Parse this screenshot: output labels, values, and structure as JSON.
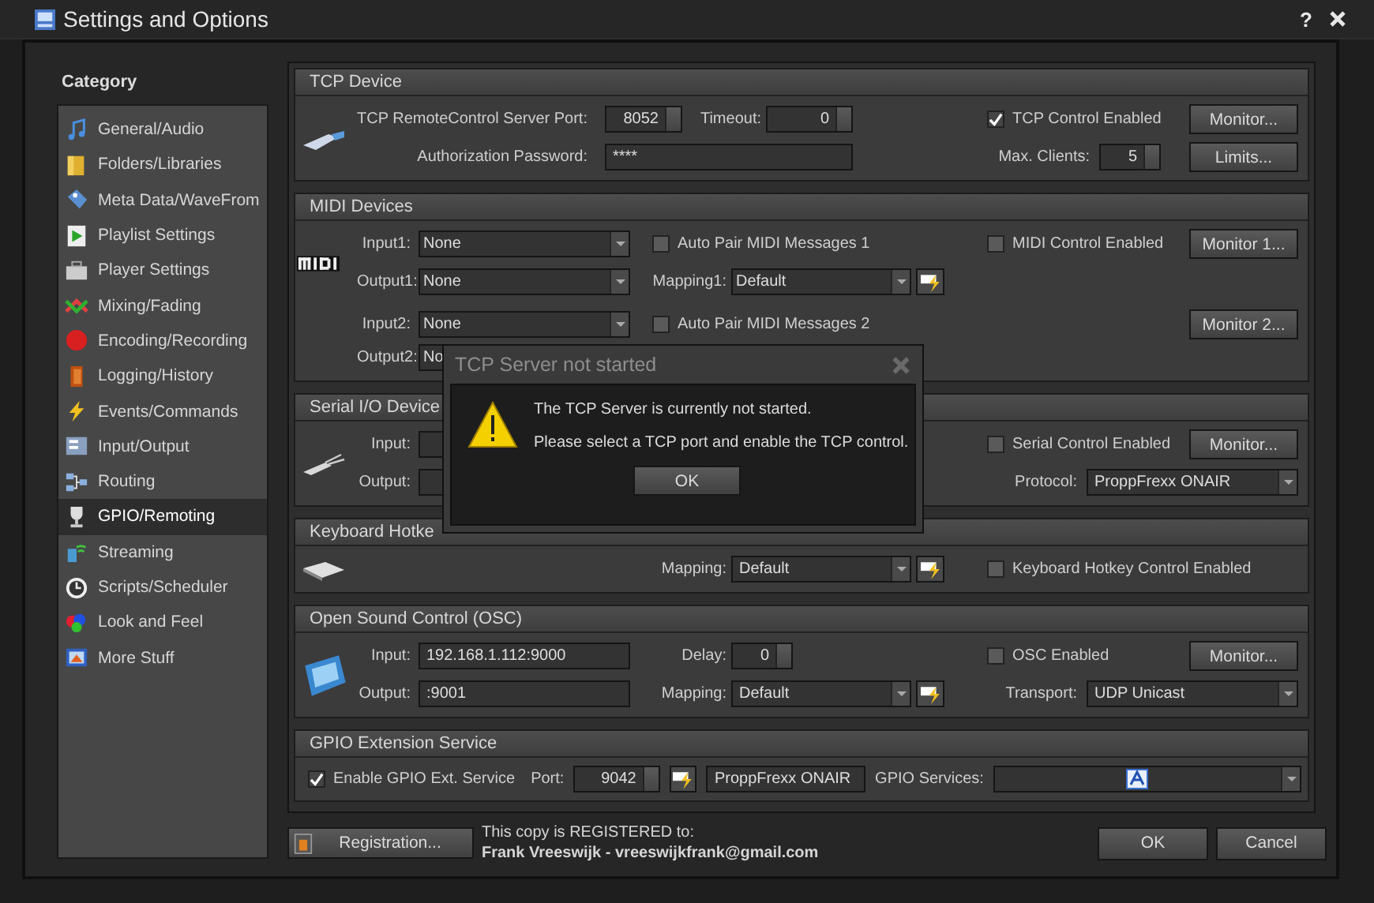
{
  "window": {
    "title": "Settings and Options",
    "help": "?"
  },
  "sidebar": {
    "heading": "Category",
    "items": [
      {
        "label": "General/Audio",
        "selected": false
      },
      {
        "label": "Folders/Libraries",
        "selected": false
      },
      {
        "label": "Meta Data/WaveFrom",
        "selected": false
      },
      {
        "label": "Playlist Settings",
        "selected": false
      },
      {
        "label": "Player Settings",
        "selected": false
      },
      {
        "label": "Mixing/Fading",
        "selected": false
      },
      {
        "label": "Encoding/Recording",
        "selected": false
      },
      {
        "label": "Logging/History",
        "selected": false
      },
      {
        "label": "Events/Commands",
        "selected": false
      },
      {
        "label": "Input/Output",
        "selected": false
      },
      {
        "label": "Routing",
        "selected": false
      },
      {
        "label": "GPIO/Remoting",
        "selected": true
      },
      {
        "label": "Streaming",
        "selected": false
      },
      {
        "label": "Scripts/Scheduler",
        "selected": false
      },
      {
        "label": "Look and Feel",
        "selected": false
      },
      {
        "label": "More Stuff",
        "selected": false
      }
    ]
  },
  "tcp": {
    "title": "TCP Device",
    "port_label": "TCP RemoteControl Server Port:",
    "port": "8052",
    "timeout_label": "Timeout:",
    "timeout": "0",
    "control_enabled": {
      "label": "TCP Control Enabled",
      "checked": true
    },
    "monitor": "Monitor...",
    "password_label": "Authorization Password:",
    "password": "****",
    "max_clients_label": "Max. Clients:",
    "max_clients": "5",
    "limits": "Limits..."
  },
  "midi": {
    "title": "MIDI Devices",
    "input1_label": "Input1:",
    "input1": "None",
    "auto_pair1": {
      "label": "Auto Pair MIDI Messages 1",
      "checked": false
    },
    "midi_enabled": {
      "label": "MIDI Control Enabled",
      "checked": false
    },
    "monitor1": "Monitor 1...",
    "output1_label": "Output1:",
    "output1": "None",
    "mapping1_label": "Mapping1:",
    "mapping1": "Default",
    "input2_label": "Input2:",
    "input2": "None",
    "auto_pair2": {
      "label": "Auto Pair MIDI Messages 2",
      "checked": false
    },
    "monitor2": "Monitor 2...",
    "output2_label": "Output2:",
    "output2": "No"
  },
  "serial": {
    "title": "Serial I/O Device",
    "input_label": "Input:",
    "output_label": "Output:",
    "serial_enabled": {
      "label": "Serial Control Enabled",
      "checked": false
    },
    "monitor": "Monitor...",
    "protocol_label": "Protocol:",
    "protocol": "ProppFrexx ONAIR"
  },
  "keyboard": {
    "title": "Keyboard Hotke",
    "mapping_label": "Mapping:",
    "mapping": "Default",
    "hotkey_enabled": {
      "label": "Keyboard Hotkey Control Enabled",
      "checked": false
    }
  },
  "osc": {
    "title": "Open Sound Control (OSC)",
    "input_label": "Input:",
    "input": "192.168.1.112:9000",
    "delay_label": "Delay:",
    "delay": "0",
    "osc_enabled": {
      "label": "OSC Enabled",
      "checked": false
    },
    "monitor": "Monitor...",
    "output_label": "Output:",
    "output": ":9001",
    "mapping_label": "Mapping:",
    "mapping": "Default",
    "transport_label": "Transport:",
    "transport": "UDP Unicast"
  },
  "gpio": {
    "title": "GPIO Extension Service",
    "enable": {
      "label": "Enable GPIO Ext. Service",
      "checked": true
    },
    "port_label": "Port:",
    "port": "9042",
    "service_name": "ProppFrexx ONAIR",
    "services_label": "GPIO Services:"
  },
  "footer": {
    "registration": "Registration...",
    "registered_line1": "This copy is REGISTERED to:",
    "registered_line2": "Frank Vreeswijk - vreeswijkfrank@gmail.com",
    "ok": "OK",
    "cancel": "Cancel"
  },
  "dialog": {
    "title": "TCP Server not started",
    "message1": "The TCP Server is currently not started.",
    "message2": "Please select a TCP port and enable the TCP control.",
    "ok": "OK"
  }
}
